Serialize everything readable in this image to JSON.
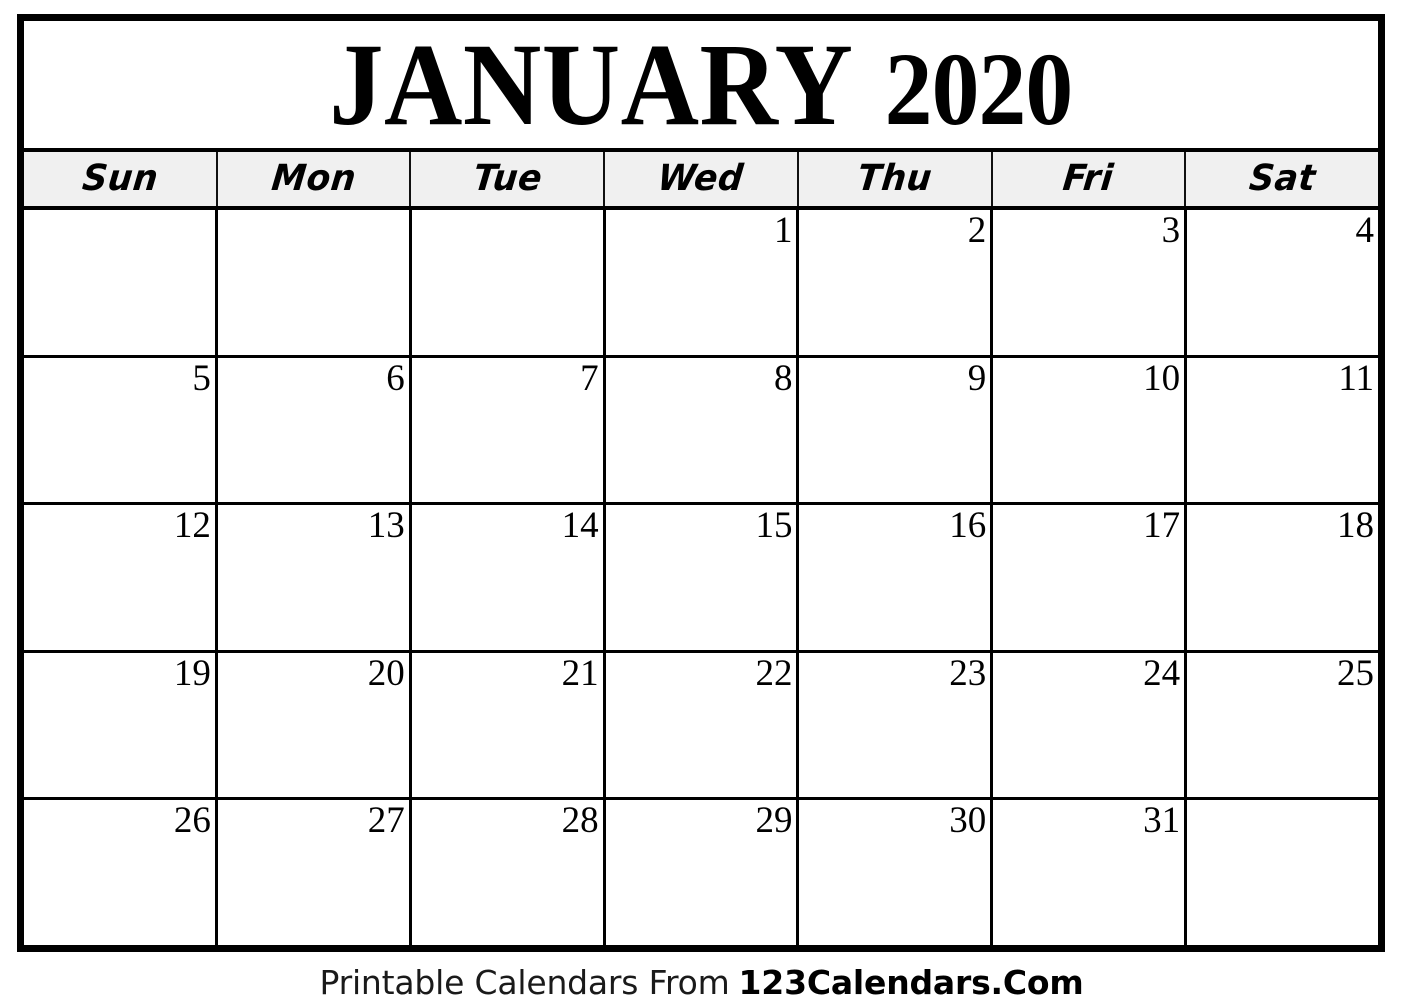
{
  "calendar": {
    "month": "JANUARY",
    "year": "2020",
    "title_full": "JANUARY 2020",
    "weekdays": [
      {
        "short": "Sun"
      },
      {
        "short": "Mon"
      },
      {
        "short": "Tue"
      },
      {
        "short": "Wed"
      },
      {
        "short": "Thu"
      },
      {
        "short": "Fri"
      },
      {
        "short": "Sat"
      }
    ],
    "weeks": [
      {
        "days": [
          "",
          "",
          "",
          "1",
          "2",
          "3",
          "4"
        ]
      },
      {
        "days": [
          "5",
          "6",
          "7",
          "8",
          "9",
          "10",
          "11"
        ]
      },
      {
        "days": [
          "12",
          "13",
          "14",
          "15",
          "16",
          "17",
          "18"
        ]
      },
      {
        "days": [
          "19",
          "20",
          "21",
          "22",
          "23",
          "24",
          "25"
        ]
      },
      {
        "days": [
          "26",
          "27",
          "28",
          "29",
          "30",
          "31",
          ""
        ]
      }
    ]
  },
  "footer": {
    "prefix": "Printable Calendars From",
    "brand": "123Calendars.Com"
  },
  "colors": {
    "frame": "#000000",
    "weekday_header_bg": "#f0f0f0",
    "cell_bg": "#ffffff",
    "text": "#000000",
    "page_bg": "#ffffff"
  }
}
